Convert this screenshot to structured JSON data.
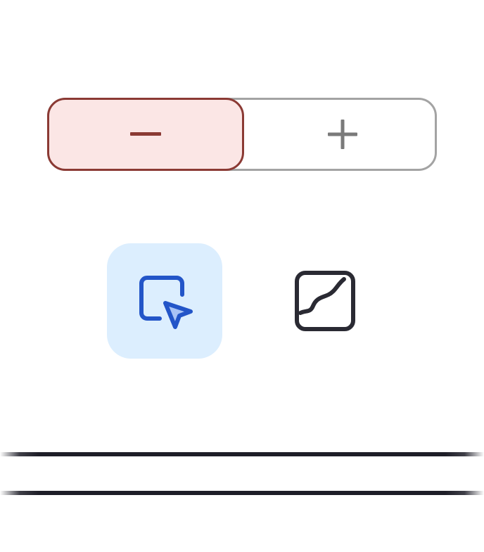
{
  "segmented_control": {
    "minus": {
      "icon": "minus-icon",
      "selected": true
    },
    "plus": {
      "icon": "plus-icon",
      "selected": false
    }
  },
  "tools": [
    {
      "icon": "select-cursor-icon",
      "active": true
    },
    {
      "icon": "curve-path-icon",
      "active": false
    }
  ],
  "colors": {
    "minus_bg": "#fbe6e5",
    "minus_border": "#8b3a34",
    "control_border": "#a3a3a3",
    "plus_glyph": "#7a7a7a",
    "tool_active_bg": "#dceefe",
    "tool_active_icon": "#2355c8",
    "tool_active_fill": "#a9c3f5",
    "tool_icon": "#2a2a33",
    "line": "#1e1e28"
  }
}
